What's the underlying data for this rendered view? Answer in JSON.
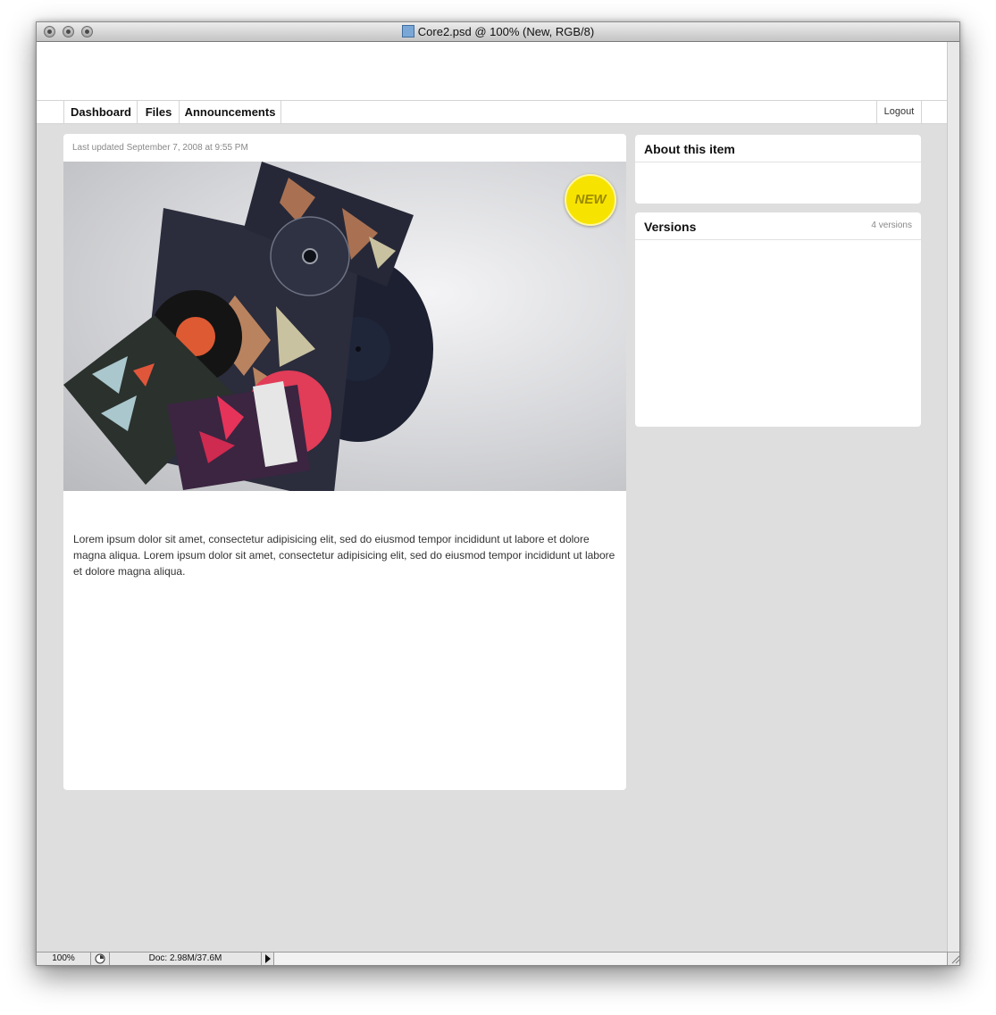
{
  "window": {
    "title": "Core2.psd @ 100% (New, RGB/8)"
  },
  "nav": {
    "items": [
      "Dashboard",
      "Files",
      "Announcements"
    ],
    "logout": "Logout"
  },
  "main": {
    "updated": "Last updated September 7, 2008 at 9:55 PM",
    "badge": "NEW",
    "body": "Lorem ipsum dolor sit amet, consectetur adipisicing elit, sed do eiusmod tempor incididunt ut labore et dolore magna aliqua. Lorem ipsum dolor sit amet, consectetur adipisicing elit, sed do eiusmod tempor incididunt ut labore et dolore magna aliqua."
  },
  "sidebar": {
    "about": {
      "title": "About this item"
    },
    "versions": {
      "title": "Versions",
      "count": "4 versions"
    }
  },
  "status": {
    "zoom": "100%",
    "doc": "Doc: 2.98M/37.6M"
  }
}
